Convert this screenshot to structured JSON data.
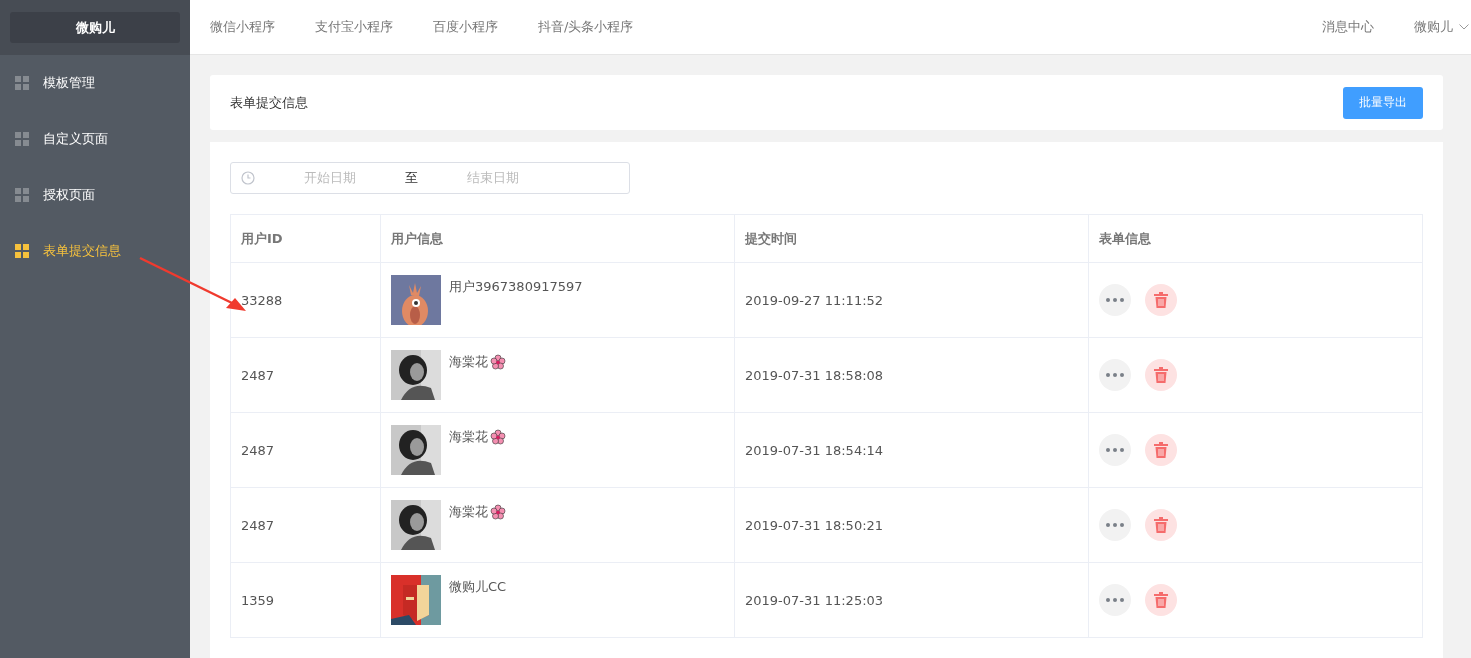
{
  "sidebar": {
    "logo": "微购儿",
    "items": [
      {
        "label": "模板管理",
        "selected": false
      },
      {
        "label": "自定义页面",
        "selected": false
      },
      {
        "label": "授权页面",
        "selected": false
      },
      {
        "label": "表单提交信息",
        "selected": true
      }
    ]
  },
  "top_nav": {
    "tabs": [
      "微信小程序",
      "支付宝小程序",
      "百度小程序",
      "抖音/头条小程序"
    ],
    "message_center": "消息中心",
    "user": "微购儿"
  },
  "header": {
    "title": "表单提交信息",
    "export_button": "批量导出"
  },
  "date_range": {
    "start_placeholder": "开始日期",
    "separator": "至",
    "end_placeholder": "结束日期"
  },
  "table": {
    "columns": [
      "用户ID",
      "用户信息",
      "提交时间",
      "表单信息"
    ],
    "rows": [
      {
        "id": "33288",
        "name": "用户3967380917597",
        "flower": false,
        "time": "2019-09-27 11:11:52"
      },
      {
        "id": "2487",
        "name": "海棠花",
        "flower": true,
        "time": "2019-07-31 18:58:08"
      },
      {
        "id": "2487",
        "name": "海棠花",
        "flower": true,
        "time": "2019-07-31 18:54:14"
      },
      {
        "id": "2487",
        "name": "海棠花",
        "flower": true,
        "time": "2019-07-31 18:50:21"
      },
      {
        "id": "1359",
        "name": "微购儿CC",
        "flower": false,
        "time": "2019-07-31 11:25:03"
      }
    ]
  }
}
